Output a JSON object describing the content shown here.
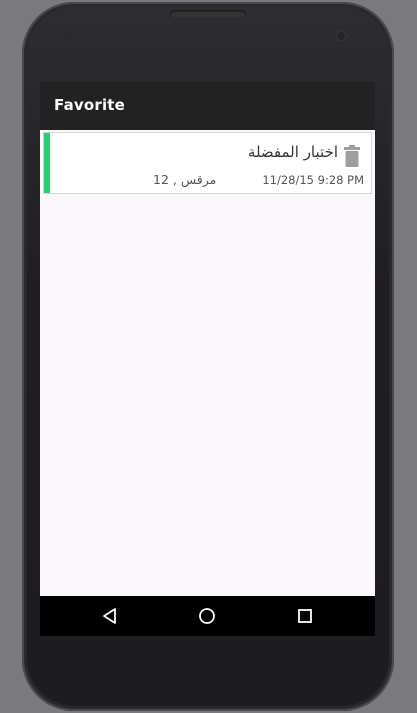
{
  "app_bar": {
    "title": "Favorite"
  },
  "favorites": [
    {
      "title": "اختبار المفضلة",
      "location": "مرقس , 12",
      "date": "11/28/15 9:28 PM",
      "accent_color": "#2ecc71",
      "delete_icon": "trash-icon"
    }
  ],
  "nav_bar": {
    "back_icon": "back-triangle-icon",
    "home_icon": "home-circle-icon",
    "recents_icon": "recents-square-icon"
  },
  "colors": {
    "app_bar_bg": "#222222",
    "content_bg": "#faf8fa",
    "accent": "#2ecc71",
    "icon_gray": "#9e9e9e"
  }
}
